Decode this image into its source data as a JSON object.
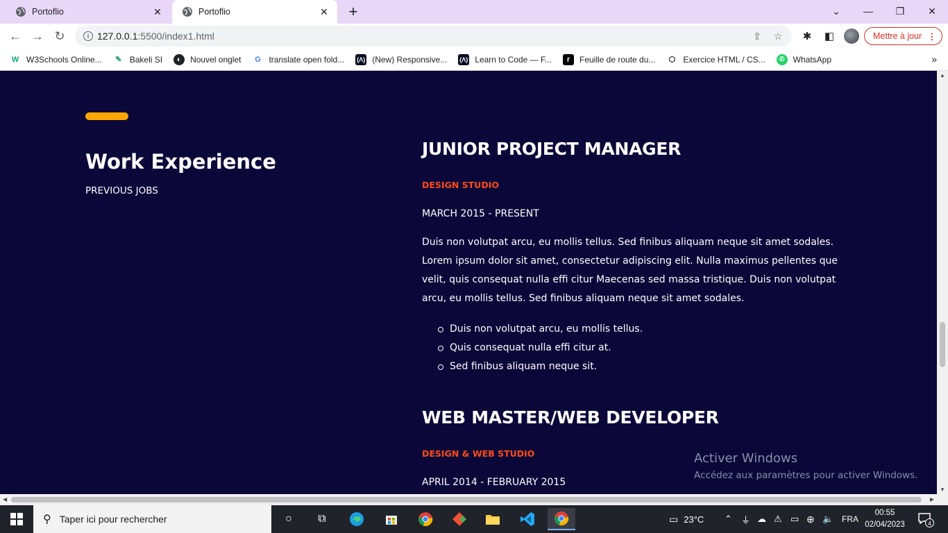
{
  "browser": {
    "tabs": [
      {
        "title": "Portoflio",
        "active": false
      },
      {
        "title": "Portoflio",
        "active": true
      }
    ],
    "url_host": "127.0.0.1",
    "url_path": ":5500/index1.html",
    "update_button": "Mettre à jour",
    "bookmarks": [
      {
        "label": "W3Schools Online...",
        "icon": "w3schools-icon"
      },
      {
        "label": "Bakeli SI",
        "icon": "bakeli-icon"
      },
      {
        "label": "Nouvel onglet",
        "icon": "globe-icon"
      },
      {
        "label": "translate open fold...",
        "icon": "google-icon"
      },
      {
        "label": "(New) Responsive...",
        "icon": "freecodecamp-icon"
      },
      {
        "label": "Learn to Code — F...",
        "icon": "freecodecamp-icon"
      },
      {
        "label": "Feuille de route du...",
        "icon": "roadmap-icon"
      },
      {
        "label": "Exercice HTML / CS...",
        "icon": "codepen-icon"
      },
      {
        "label": "WhatsApp",
        "icon": "whatsapp-icon"
      }
    ]
  },
  "page": {
    "section_title": "Work Experience",
    "section_subtitle": "PREVIOUS JOBS",
    "jobs": [
      {
        "title": "JUNIOR PROJECT MANAGER",
        "company": "DESIGN STUDIO",
        "dates": "MARCH 2015 - PRESENT",
        "description": "Duis non volutpat arcu, eu mollis tellus. Sed finibus aliquam neque sit amet sodales. Lorem ipsum dolor sit amet, consectetur adipiscing elit. Nulla maximus pellentes que velit, quis consequat nulla effi citur Maecenas sed massa tristique. Duis non volutpat arcu, eu mollis tellus. Sed finibus aliquam neque sit amet sodales.",
        "bullets": [
          "Duis non volutpat arcu, eu mollis tellus.",
          "Quis consequat nulla effi citur at.",
          "Sed finibus aliquam neque sit."
        ]
      },
      {
        "title": "WEB MASTER/WEB DEVELOPER",
        "company": "DESIGN & WEB STUDIO",
        "dates": "APRIL 2014 - FEBRUARY 2015"
      }
    ],
    "watermark_title": "Activer Windows",
    "watermark_text": "Accédez aux paramètres pour activer Windows."
  },
  "taskbar": {
    "search_placeholder": "Taper ici pour rechercher",
    "temperature": "23°C",
    "language": "FRA",
    "time": "00:55",
    "date": "02/04/2023",
    "notification_count": "4"
  },
  "colors": {
    "page_background": "#0b0739",
    "accent_bar": "#ffa600",
    "company_text": "#ff4a17",
    "tabstrip": "#e9d7f7"
  }
}
